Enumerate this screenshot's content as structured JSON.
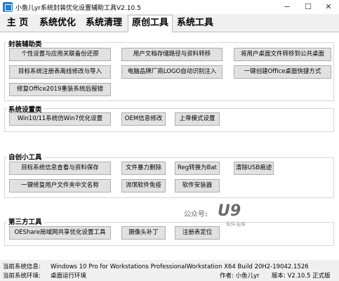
{
  "window": {
    "title": "小鱼儿yr系统封装优化设置辅助工具V2.10.5",
    "minimize": "−",
    "maximize": "☐",
    "close": "✕"
  },
  "tabs": [
    {
      "label": "主 页",
      "active": false
    },
    {
      "label": "系统优化",
      "active": false
    },
    {
      "label": "系统清理",
      "active": false
    },
    {
      "label": "原创工具",
      "active": true
    },
    {
      "label": "系统工具",
      "active": false
    }
  ],
  "groups": {
    "packaging": {
      "title": "封装辅助类",
      "buttons": [
        "个性设置与应用关联备份还原",
        "用户文档存储路径与资料转移",
        "将用户桌面文件转移到公共桌面",
        "目标系统注册表离线修改与导入",
        "电脑品牌厂商LOGO自动识别注入",
        "一键创建Office桌面快捷方式",
        "修复Office2019重装系统后报错"
      ]
    },
    "system_settings": {
      "title": "系统设置类",
      "buttons": [
        "Win10/11系统仿Win7优化设置",
        "OEM信息修改",
        "上帝模式设置"
      ]
    },
    "custom_tools": {
      "title": "自创小工具",
      "buttons": [
        "目标系统信息查看与资料保存",
        "文件暴力删除",
        "Reg转换为Bat",
        "清除USB痕迹",
        "一键修复用户文件夹中文名称",
        "流氓软件免疫",
        "软件安装器"
      ]
    },
    "third_party": {
      "title": "第三方工具",
      "buttons": [
        "OEShare局域网共享优化设置工具",
        "摄像头补丁",
        "注册表定位"
      ]
    }
  },
  "watermark": {
    "text": "公众号:",
    "logo": "U9",
    "sub": "软件宝库"
  },
  "status": {
    "system_info_label": "当前系统信息:",
    "system_info_value": "Windows 10 Pro for Workstations ProfessionalWorkstation X64 Build 20H2-19042.1526",
    "env_label": "当前系统环境:",
    "env_value": "桌面运行环境",
    "author": "作者: 小鱼儿yr",
    "version": "版本: V2.10.5 正式版"
  }
}
